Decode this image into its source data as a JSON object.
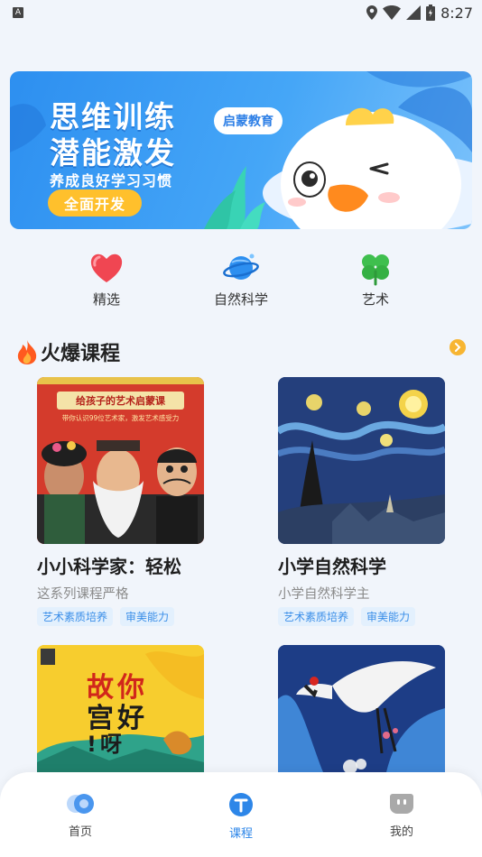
{
  "status_bar": {
    "app_badge": "A",
    "time": "8:27"
  },
  "banner": {
    "title_line1": "思维训练",
    "title_line2": "潜能激发",
    "subtitle": "养成良好学习习惯",
    "button_label": "全面开发",
    "brand_label": "启蒙教育"
  },
  "categories": [
    {
      "label": "精选",
      "icon": "heart-icon"
    },
    {
      "label": "自然科学",
      "icon": "planet-icon"
    },
    {
      "label": "艺术",
      "icon": "clover-icon"
    }
  ],
  "section": {
    "title": "火爆课程",
    "icon": "fire-icon",
    "more_icon": "chevron-right-icon"
  },
  "courses": [
    {
      "title": "小小科学家：轻松",
      "desc": "这系列课程严格",
      "tags": [
        "艺术素质培养",
        "审美能力"
      ],
      "cover_line1": "给孩子的艺术启蒙课",
      "cover_line2": "带你认识99位艺术家，激发艺术感受力"
    },
    {
      "title": "小学自然科学",
      "desc": "小学自然科学主",
      "tags": [
        "艺术素质培养",
        "审美能力"
      ]
    },
    {
      "cover_line1": "故你",
      "cover_line2": "宫好",
      "cover_line3": "!呀"
    },
    {}
  ],
  "bottom_nav": [
    {
      "label": "首页",
      "icon": "home-icon",
      "active": false
    },
    {
      "label": "课程",
      "icon": "course-icon",
      "active": true
    },
    {
      "label": "我的",
      "icon": "profile-icon",
      "active": false
    }
  ],
  "colors": {
    "accent": "#2d86e8",
    "banner": "#2d8ff0",
    "button_yellow": "#ffc02c",
    "tag_bg": "#e3f0fd",
    "tag_text": "#3a8ee8"
  }
}
